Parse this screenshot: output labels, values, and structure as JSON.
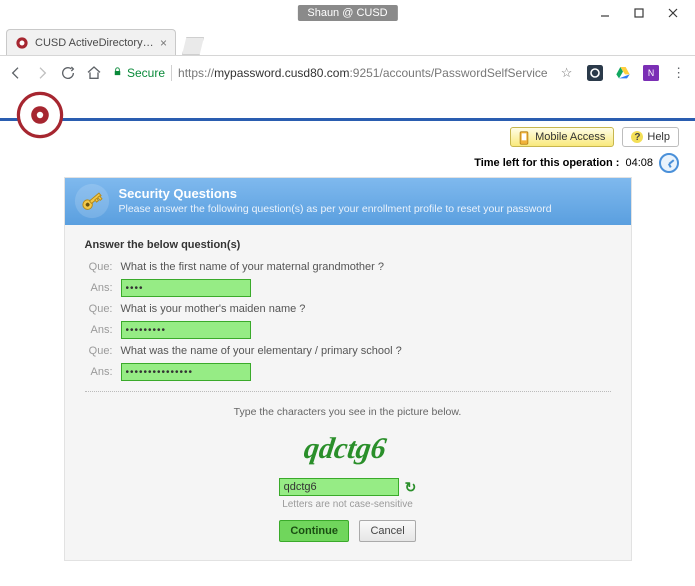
{
  "window": {
    "user_pill": "Shaun @ CUSD"
  },
  "tab": {
    "title": "CUSD ActiveDirectory Pa"
  },
  "address": {
    "secure_label": "Secure",
    "scheme": "https",
    "host": "mypassword.cusd80.com",
    "port": ":9251",
    "path": "/accounts/PasswordSelfService"
  },
  "utility": {
    "mobile_access": "Mobile Access",
    "help": "Help"
  },
  "timer": {
    "label": "Time left for this operation :",
    "value": "04:08"
  },
  "panel": {
    "title": "Security Questions",
    "subtitle": "Please answer the following question(s) as per your enrollment profile to reset your password"
  },
  "instruction": "Answer the below question(s)",
  "labels": {
    "que": "Que:",
    "ans": "Ans:"
  },
  "questions": [
    {
      "text": "What is the first name of your maternal grandmother ?",
      "answer_mask": "••••"
    },
    {
      "text": "What is your mother's maiden name ?",
      "answer_mask": "•••••••••"
    },
    {
      "text": "What was the name of your elementary / primary school ?",
      "answer_mask": "•••••••••••••••"
    }
  ],
  "captcha": {
    "instruction": "Type the characters you see in the picture below.",
    "text": "qdctg6",
    "input_value": "qdctg6",
    "note": "Letters are not case-sensitive"
  },
  "buttons": {
    "continue": "Continue",
    "cancel": "Cancel"
  }
}
